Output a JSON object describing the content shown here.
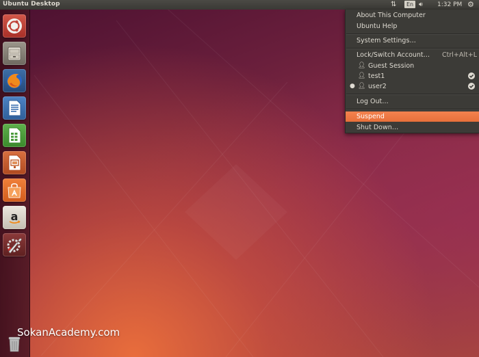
{
  "topbar": {
    "title": "Ubuntu Desktop",
    "arrows_glyph": "⇅",
    "language": "En",
    "volume_glyph": "🔊︎",
    "clock": "1:32 PM",
    "gear_glyph": "⚙"
  },
  "launcher": {
    "items": [
      {
        "name": "dash-home",
        "icon": "ubuntu-logo-icon"
      },
      {
        "name": "files",
        "icon": "file-cabinet-icon"
      },
      {
        "name": "firefox",
        "icon": "firefox-icon"
      },
      {
        "name": "libreoffice-writer",
        "icon": "writer-icon"
      },
      {
        "name": "libreoffice-calc",
        "icon": "calc-icon"
      },
      {
        "name": "libreoffice-impress",
        "icon": "impress-icon"
      },
      {
        "name": "ubuntu-software-center",
        "icon": "shopping-bag-icon"
      },
      {
        "name": "amazon",
        "icon": "amazon-icon"
      },
      {
        "name": "system-settings",
        "icon": "settings-wrench-icon"
      },
      {
        "name": "trash",
        "icon": "trash-icon"
      }
    ],
    "colors": {
      "dash": "#c0443a",
      "files": "#8a8479",
      "firefox": "#2c5d98",
      "writer": "#3a6fb0",
      "calc": "#4a9a3a",
      "impress": "#c05a2a",
      "software": "#e8742f",
      "amazon": "#d9d4c8",
      "settings": "#7a2f2f"
    }
  },
  "session_menu": {
    "about": "About This Computer",
    "help": "Ubuntu Help",
    "settings": "System Settings…",
    "lock": "Lock/Switch Account…",
    "lock_shortcut": "Ctrl+Alt+L",
    "users": [
      {
        "name": "Guest Session",
        "active": false,
        "logged_in": false
      },
      {
        "name": "test1",
        "active": false,
        "logged_in": true
      },
      {
        "name": "user2",
        "active": true,
        "logged_in": true
      }
    ],
    "logout": "Log Out…",
    "suspend": "Suspend",
    "shutdown": "Shut Down…",
    "highlight_color": "#f07746"
  },
  "watermark": "SokanAcademy.com"
}
